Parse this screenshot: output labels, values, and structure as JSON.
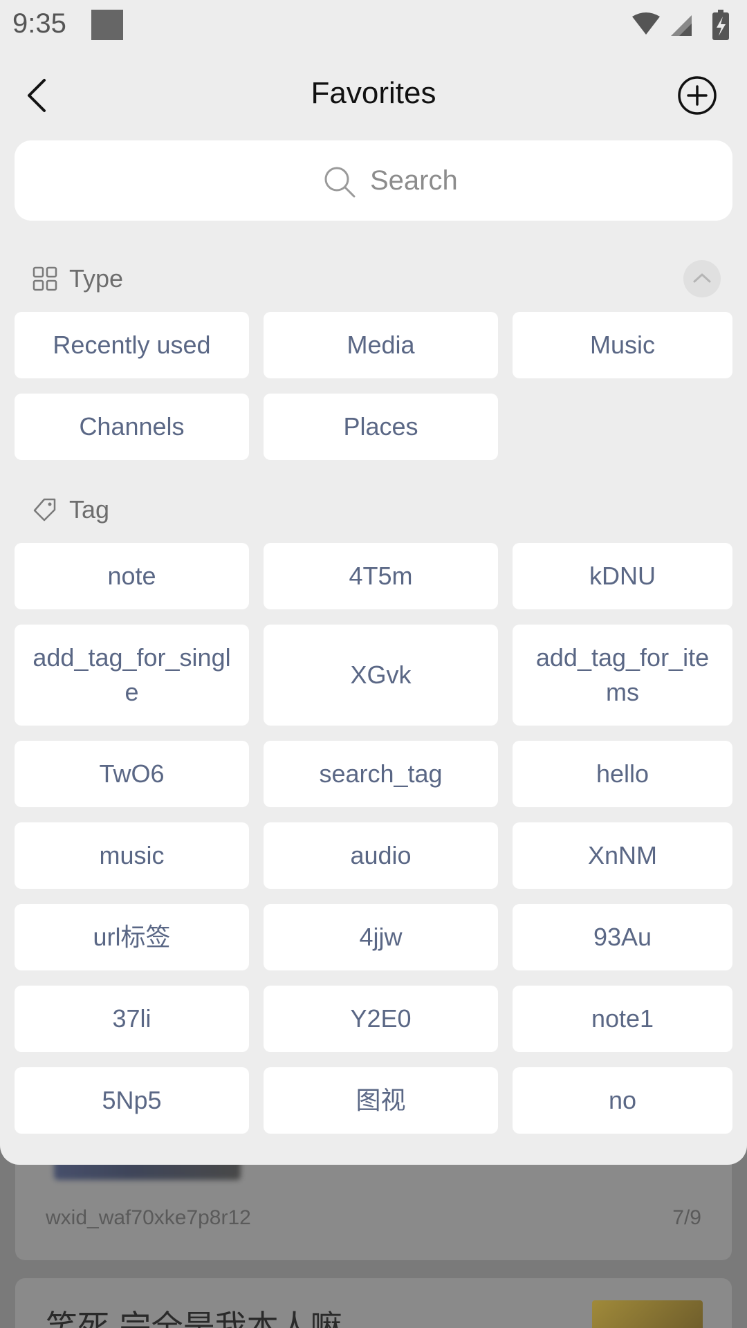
{
  "status_bar": {
    "time": "9:35"
  },
  "header": {
    "title": "Favorites"
  },
  "search": {
    "placeholder": "Search"
  },
  "type_section": {
    "label": "Type",
    "items": [
      "Recently used",
      "Media",
      "Music",
      "Channels",
      "Places"
    ]
  },
  "tag_section": {
    "label": "Tag",
    "items": [
      "note",
      "4T5m",
      "kDNU",
      "add_tag_for_single",
      "XGvk",
      "add_tag_for_items",
      "TwO6",
      "search_tag",
      "hello",
      "music",
      "audio",
      "XnNM",
      "url标签",
      "4jjw",
      "93Au",
      "37li",
      "Y2E0",
      "note1",
      "5Np5",
      "图视",
      "no"
    ]
  },
  "background": {
    "card1_meta_left": "wxid_waf70xke7p8r12",
    "card1_meta_right": "7/9",
    "card2_title": "笑死 完全是我本人嘛"
  }
}
